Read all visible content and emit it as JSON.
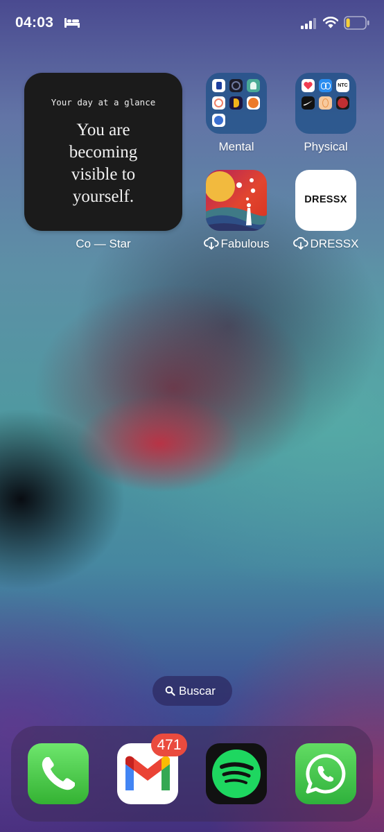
{
  "status_bar": {
    "time": "04:03",
    "focus_icon": "bed-icon",
    "signal_icon": "cellular-signal-icon",
    "wifi_icon": "wifi-icon",
    "battery_icon": "battery-low-icon",
    "battery_level": 0.2,
    "battery_color": "#f5cf3a"
  },
  "widget": {
    "header": "Your day at a glance",
    "quote_lines": [
      "You are",
      "becoming",
      "visible to",
      "yourself."
    ],
    "label": "Co — Star"
  },
  "apps": {
    "mental": {
      "label": "Mental"
    },
    "physical": {
      "label": "Physical",
      "mini_labels": [
        "NTC",
        "NRC"
      ]
    },
    "fabulous": {
      "label": "Fabulous",
      "downloading": true
    },
    "dressx": {
      "label": "DRESSX",
      "wordmark": "DRESSX",
      "downloading": true
    }
  },
  "search": {
    "label": "Buscar"
  },
  "dock": {
    "apps": [
      {
        "name": "Phone",
        "icon": "phone-icon"
      },
      {
        "name": "Gmail",
        "icon": "gmail-icon",
        "badge": "471"
      },
      {
        "name": "Spotify",
        "icon": "spotify-icon"
      },
      {
        "name": "WhatsApp",
        "icon": "whatsapp-icon"
      }
    ]
  },
  "colors": {
    "badge": "#ea4b3e",
    "widget_bg": "#1b1b1b",
    "folder_bg": "#1e5087",
    "phone_green": "#4ccd4b",
    "spotify_green": "#1ed760",
    "whatsapp_green": "#3fc04a"
  }
}
